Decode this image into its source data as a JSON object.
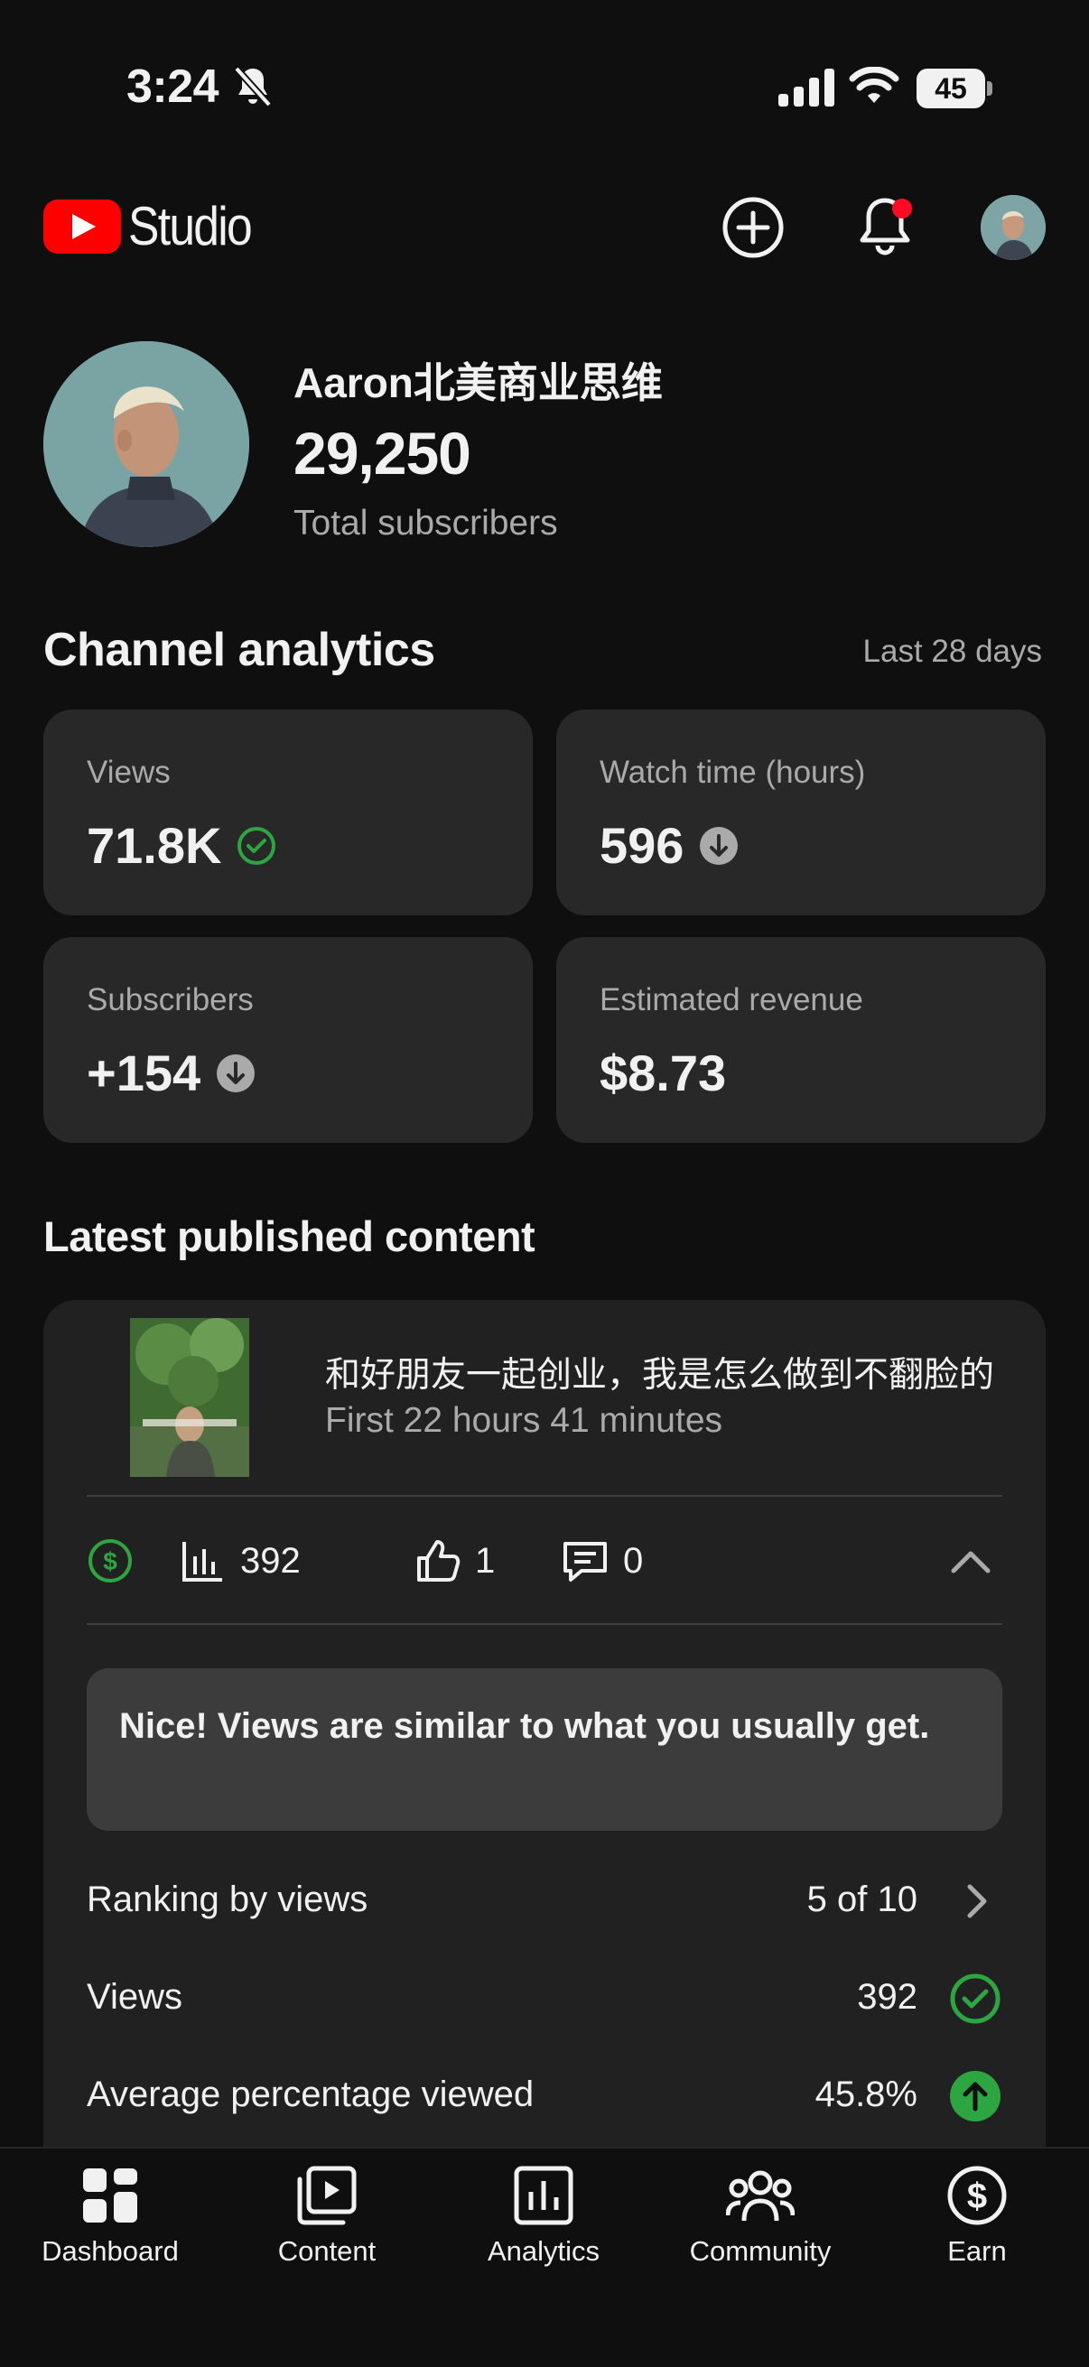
{
  "status_bar": {
    "time": "3:24",
    "battery": "45",
    "icons": [
      "bell-off-icon",
      "signal-icon",
      "wifi-icon",
      "battery-icon"
    ]
  },
  "header": {
    "logo_text": "Studio",
    "icons": [
      "create-icon",
      "notifications-icon",
      "account-avatar"
    ]
  },
  "channel": {
    "name": "Aaron北美商业思维",
    "subscribers": "29,250",
    "subscribers_label": "Total subscribers"
  },
  "analytics": {
    "title": "Channel analytics",
    "period": "Last 28 days",
    "cards": [
      {
        "label": "Views",
        "value": "71.8K",
        "status": "check"
      },
      {
        "label": "Watch time (hours)",
        "value": "596",
        "status": "down"
      },
      {
        "label": "Subscribers",
        "value": "+154",
        "status": "down"
      },
      {
        "label": "Estimated revenue",
        "value": "$8.73",
        "status": "none"
      }
    ]
  },
  "latest": {
    "title": "Latest published content",
    "video_title": "和好朋友一起创业，我是怎么做到不翻脸的",
    "video_sub": "First 22 hours 41 minutes",
    "stats": {
      "views": "392",
      "likes": "1",
      "comments": "0"
    },
    "insight": "Nice! Views are similar to what you usually get.",
    "metrics": [
      {
        "label": "Ranking by views",
        "value": "5 of 10",
        "icon": "chevron-right-icon"
      },
      {
        "label": "Views",
        "value": "392",
        "icon": "check-circle-icon"
      },
      {
        "label": "Average percentage viewed",
        "value": "45.8%",
        "icon": "arrow-up-circle-icon"
      }
    ]
  },
  "nav": [
    {
      "label": "Dashboard",
      "icon": "dashboard-icon"
    },
    {
      "label": "Content",
      "icon": "content-icon"
    },
    {
      "label": "Analytics",
      "icon": "analytics-icon"
    },
    {
      "label": "Community",
      "icon": "community-icon"
    },
    {
      "label": "Earn",
      "icon": "earn-icon"
    }
  ],
  "colors": {
    "background": "#0f0f0f",
    "card": "#282828",
    "brand_red": "#ff0000",
    "success_green": "#2ba640",
    "muted_text": "#aaaaaa"
  }
}
